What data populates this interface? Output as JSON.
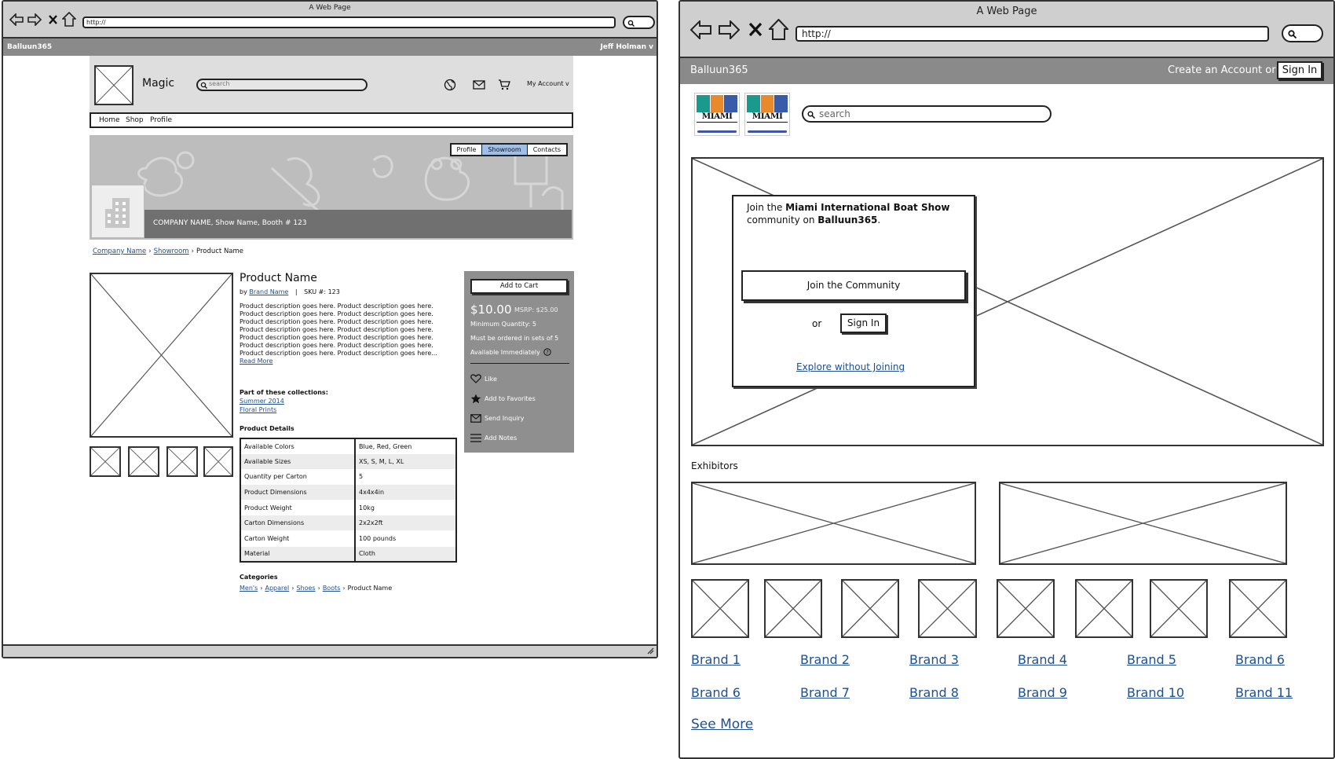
{
  "left_window": {
    "title": "A Web Page",
    "url": "http://",
    "app_bar": {
      "brand": "Balluun365",
      "user": "Jeff Holman v"
    },
    "header": {
      "site_name": "Magic",
      "search_placeholder": "search",
      "account_label": "My Account v"
    },
    "nav": [
      "Home",
      "Shop",
      "Profile"
    ],
    "banner": {
      "tabs": [
        {
          "label": "Profile",
          "active": false
        },
        {
          "label": "Showroom",
          "active": true
        },
        {
          "label": "Contacts",
          "active": false
        }
      ],
      "caption": "COMPANY NAME, Show Name, Booth # 123"
    },
    "breadcrumb": {
      "links": [
        "Company Name",
        "Showroom"
      ],
      "current": "Product Name"
    },
    "product": {
      "name": "Product Name",
      "by_prefix": "by",
      "brand": "Brand Name",
      "sku": "SKU #: 123",
      "description": "Product description goes here. Product description goes here. Product description goes here. Product description goes here. Product description goes here. Product description goes here. Product description goes here. Product description goes here. Product description goes here. Product description goes here. Product description goes here. Product description goes here. Product description goes here. Product description goes here...",
      "read_more": "Read More",
      "collections_heading": "Part of these collections:",
      "collections": [
        "Summer 2014",
        "Floral Prints"
      ],
      "details_heading": "Product Details",
      "details": [
        [
          "Available Colors",
          "Blue, Red, Green"
        ],
        [
          "Available Sizes",
          "XS, S, M, L, XL"
        ],
        [
          "Quantity per Carton",
          "5"
        ],
        [
          "Product Dimensions",
          "4x4x4in"
        ],
        [
          "Product Weight",
          "10kg"
        ],
        [
          "Carton Dimensions",
          "2x2x2ft"
        ],
        [
          "Carton Weight",
          "100 pounds"
        ],
        [
          "Material",
          "Cloth"
        ]
      ],
      "categories_heading": "Categories",
      "categories": {
        "links": [
          "Men's",
          "Apparel",
          "Shoes",
          "Boots"
        ],
        "current": "Product Name"
      }
    },
    "buy_box": {
      "add_to_cart": "Add to Cart",
      "price": "$10.00",
      "msrp": "MSRP: $25.00",
      "min_qty": "Minimum Quantity: 5",
      "sets": "Must be ordered in sets of 5",
      "availability": "Available Immediately",
      "actions": [
        "Like",
        "Add to Favorites",
        "Send Inquiry",
        "Add Notes"
      ]
    }
  },
  "right_window": {
    "title": "A Web Page",
    "url": "http://",
    "app_bar": {
      "brand": "Balluun365",
      "create": "Create an Account or",
      "sign_in": "Sign In"
    },
    "logo_text": "MIAMI",
    "search_placeholder": "search",
    "modal": {
      "line1_prefix": "Join the ",
      "line1_bold": "Miami International Boat Show",
      "line2_prefix": "community on ",
      "line2_bold": "Balluun365",
      "line2_suffix": ".",
      "join_button": "Join the Community",
      "or": "or",
      "sign_in": "Sign In",
      "explore": "Explore without Joining"
    },
    "exhibitors_heading": "Exhibitors",
    "brands": [
      "Brand 1",
      "Brand 2",
      "Brand 3",
      "Brand 4",
      "Brand 5",
      "Brand 6",
      "Brand 6",
      "Brand 7",
      "Brand 8",
      "Brand 9",
      "Brand 10",
      "Brand 11"
    ],
    "see_more": "See More"
  }
}
